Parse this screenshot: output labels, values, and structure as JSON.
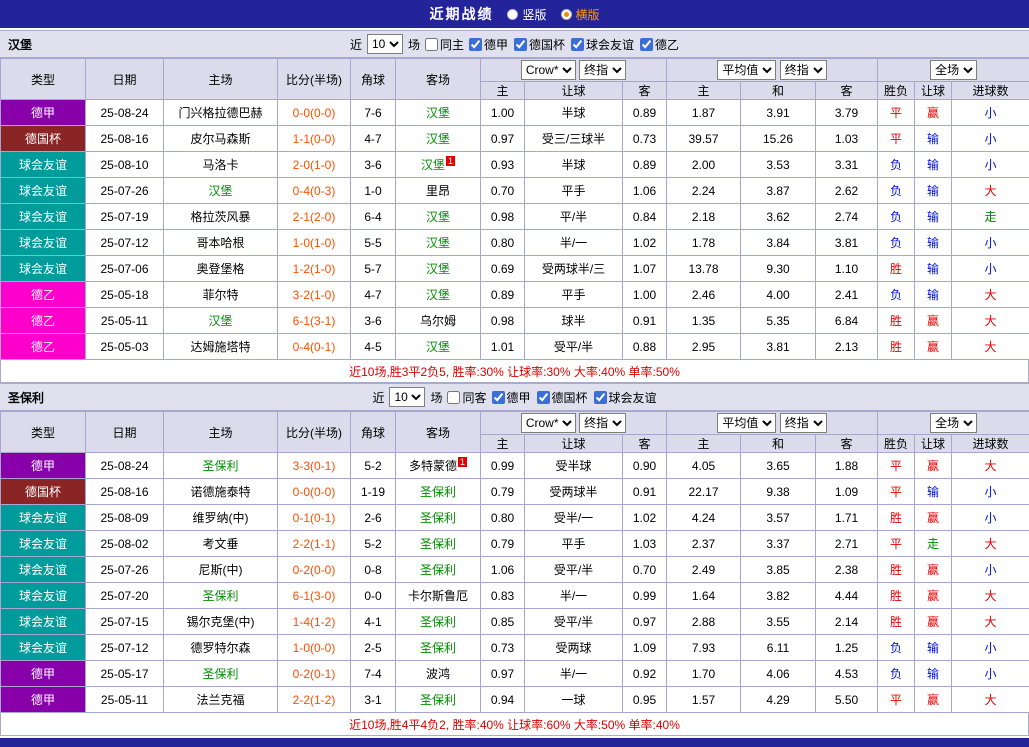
{
  "topbar": {
    "title": "近期战绩",
    "layout_vertical": "竖版",
    "layout_horizontal": "横版"
  },
  "league_colors": {
    "德甲": "#8800AA",
    "德国杯": "#8B2525",
    "球会友谊": "#009C9C",
    "德乙": "#FF00CC"
  },
  "status_colors": {
    "win": "#E60000",
    "loss": "#0010DD",
    "push": "#008A00",
    "score": "#FF5000",
    "focus_team": "#009000"
  },
  "table_header": {
    "type": "类型",
    "date": "日期",
    "home": "主场",
    "score": "比分(半场)",
    "corner": "角球",
    "away": "客场",
    "odds_company": "Crow*",
    "odds_kind": "终指",
    "avg_label": "平均值",
    "avg_kind": "终指",
    "full_label": "全场",
    "odds_sub_home": "主",
    "odds_sub_handicap": "让球",
    "odds_sub_away": "客",
    "avg_sub_home": "主",
    "avg_sub_draw": "和",
    "avg_sub_away": "客",
    "res_sub_outcome": "胜负",
    "res_sub_handicap": "让球",
    "res_sub_goals": "进球数"
  },
  "sections": [
    {
      "team": "汉堡",
      "filter": {
        "prefix": "近",
        "count": "10",
        "suffix": "场",
        "venue_label": "同主",
        "leagues": [
          "德甲",
          "德国杯",
          "球会友谊",
          "德乙"
        ]
      },
      "rows": [
        {
          "league": "德甲",
          "date": "25-08-24",
          "home": "门兴格拉德巴赫",
          "home_focus": false,
          "score": "0-0(0-0)",
          "corner": "7-6",
          "away": "汉堡",
          "away_focus": true,
          "away_rank": "",
          "odds": [
            "1.00",
            "半球",
            "0.89"
          ],
          "avg": [
            "1.87",
            "3.91",
            "3.79"
          ],
          "result": [
            "平",
            "赢",
            "小"
          ]
        },
        {
          "league": "德国杯",
          "date": "25-08-16",
          "home": "皮尔马森斯",
          "home_focus": false,
          "score": "1-1(0-0)",
          "corner": "4-7",
          "away": "汉堡",
          "away_focus": true,
          "away_rank": "",
          "odds": [
            "0.97",
            "受三/三球半",
            "0.73"
          ],
          "avg": [
            "39.57",
            "15.26",
            "1.03"
          ],
          "result": [
            "平",
            "输",
            "小"
          ]
        },
        {
          "league": "球会友谊",
          "date": "25-08-10",
          "home": "马洛卡",
          "home_focus": false,
          "score": "2-0(1-0)",
          "corner": "3-6",
          "away": "汉堡",
          "away_focus": true,
          "away_rank": "1",
          "odds": [
            "0.93",
            "半球",
            "0.89"
          ],
          "avg": [
            "2.00",
            "3.53",
            "3.31"
          ],
          "result": [
            "负",
            "输",
            "小"
          ]
        },
        {
          "league": "球会友谊",
          "date": "25-07-26",
          "home": "汉堡",
          "home_focus": true,
          "score": "0-4(0-3)",
          "corner": "1-0",
          "away": "里昂",
          "away_focus": false,
          "away_rank": "",
          "odds": [
            "0.70",
            "平手",
            "1.06"
          ],
          "avg": [
            "2.24",
            "3.87",
            "2.62"
          ],
          "result": [
            "负",
            "输",
            "大"
          ]
        },
        {
          "league": "球会友谊",
          "date": "25-07-19",
          "home": "格拉茨风暴",
          "home_focus": false,
          "score": "2-1(2-0)",
          "corner": "6-4",
          "away": "汉堡",
          "away_focus": true,
          "away_rank": "",
          "odds": [
            "0.98",
            "平/半",
            "0.84"
          ],
          "avg": [
            "2.18",
            "3.62",
            "2.74"
          ],
          "result": [
            "负",
            "输",
            "走"
          ]
        },
        {
          "league": "球会友谊",
          "date": "25-07-12",
          "home": "哥本哈根",
          "home_focus": false,
          "score": "1-0(1-0)",
          "corner": "5-5",
          "away": "汉堡",
          "away_focus": true,
          "away_rank": "",
          "odds": [
            "0.80",
            "半/一",
            "1.02"
          ],
          "avg": [
            "1.78",
            "3.84",
            "3.81"
          ],
          "result": [
            "负",
            "输",
            "小"
          ]
        },
        {
          "league": "球会友谊",
          "date": "25-07-06",
          "home": "奥登堡格",
          "home_focus": false,
          "score": "1-2(1-0)",
          "corner": "5-7",
          "away": "汉堡",
          "away_focus": true,
          "away_rank": "",
          "odds": [
            "0.69",
            "受两球半/三",
            "1.07"
          ],
          "avg": [
            "13.78",
            "9.30",
            "1.10"
          ],
          "result": [
            "胜",
            "输",
            "小"
          ]
        },
        {
          "league": "德乙",
          "date": "25-05-18",
          "home": "菲尔特",
          "home_focus": false,
          "score": "3-2(1-0)",
          "corner": "4-7",
          "away": "汉堡",
          "away_focus": true,
          "away_rank": "",
          "odds": [
            "0.89",
            "平手",
            "1.00"
          ],
          "avg": [
            "2.46",
            "4.00",
            "2.41"
          ],
          "result": [
            "负",
            "输",
            "大"
          ]
        },
        {
          "league": "德乙",
          "date": "25-05-11",
          "home": "汉堡",
          "home_focus": true,
          "score": "6-1(3-1)",
          "corner": "3-6",
          "away": "乌尔姆",
          "away_focus": false,
          "away_rank": "",
          "odds": [
            "0.98",
            "球半",
            "0.91"
          ],
          "avg": [
            "1.35",
            "5.35",
            "6.84"
          ],
          "result": [
            "胜",
            "赢",
            "大"
          ]
        },
        {
          "league": "德乙",
          "date": "25-05-03",
          "home": "达姆施塔特",
          "home_focus": false,
          "score": "0-4(0-1)",
          "corner": "4-5",
          "away": "汉堡",
          "away_focus": true,
          "away_rank": "",
          "odds": [
            "1.01",
            "受平/半",
            "0.88"
          ],
          "avg": [
            "2.95",
            "3.81",
            "2.13"
          ],
          "result": [
            "胜",
            "赢",
            "大"
          ]
        }
      ],
      "footer": "近10场,胜3平2负5, 胜率:30% 让球率:30% 大率:40% 单率:50%"
    },
    {
      "team": "圣保利",
      "filter": {
        "prefix": "近",
        "count": "10",
        "suffix": "场",
        "venue_label": "同客",
        "leagues": [
          "德甲",
          "德国杯",
          "球会友谊"
        ]
      },
      "rows": [
        {
          "league": "德甲",
          "date": "25-08-24",
          "home": "圣保利",
          "home_focus": true,
          "score": "3-3(0-1)",
          "corner": "5-2",
          "away": "多特蒙德",
          "away_focus": false,
          "away_rank": "1",
          "odds": [
            "0.99",
            "受半球",
            "0.90"
          ],
          "avg": [
            "4.05",
            "3.65",
            "1.88"
          ],
          "result": [
            "平",
            "赢",
            "大"
          ]
        },
        {
          "league": "德国杯",
          "date": "25-08-16",
          "home": "诺德施泰特",
          "home_focus": false,
          "score": "0-0(0-0)",
          "corner": "1-19",
          "away": "圣保利",
          "away_focus": true,
          "away_rank": "",
          "odds": [
            "0.79",
            "受两球半",
            "0.91"
          ],
          "avg": [
            "22.17",
            "9.38",
            "1.09"
          ],
          "result": [
            "平",
            "输",
            "小"
          ]
        },
        {
          "league": "球会友谊",
          "date": "25-08-09",
          "home": "维罗纳(中)",
          "home_focus": false,
          "score": "0-1(0-1)",
          "corner": "2-6",
          "away": "圣保利",
          "away_focus": true,
          "away_rank": "",
          "odds": [
            "0.80",
            "受半/一",
            "1.02"
          ],
          "avg": [
            "4.24",
            "3.57",
            "1.71"
          ],
          "result": [
            "胜",
            "赢",
            "小"
          ]
        },
        {
          "league": "球会友谊",
          "date": "25-08-02",
          "home": "考文垂",
          "home_focus": false,
          "score": "2-2(1-1)",
          "corner": "5-2",
          "away": "圣保利",
          "away_focus": true,
          "away_rank": "",
          "odds": [
            "0.79",
            "平手",
            "1.03"
          ],
          "avg": [
            "2.37",
            "3.37",
            "2.71"
          ],
          "result": [
            "平",
            "走",
            "大"
          ]
        },
        {
          "league": "球会友谊",
          "date": "25-07-26",
          "home": "尼斯(中)",
          "home_focus": false,
          "score": "0-2(0-0)",
          "corner": "0-8",
          "away": "圣保利",
          "away_focus": true,
          "away_rank": "",
          "odds": [
            "1.06",
            "受平/半",
            "0.70"
          ],
          "avg": [
            "2.49",
            "3.85",
            "2.38"
          ],
          "result": [
            "胜",
            "赢",
            "小"
          ]
        },
        {
          "league": "球会友谊",
          "date": "25-07-20",
          "home": "圣保利",
          "home_focus": true,
          "score": "6-1(3-0)",
          "corner": "0-0",
          "away": "卡尔斯鲁厄",
          "away_focus": false,
          "away_rank": "",
          "odds": [
            "0.83",
            "半/一",
            "0.99"
          ],
          "avg": [
            "1.64",
            "3.82",
            "4.44"
          ],
          "result": [
            "胜",
            "赢",
            "大"
          ]
        },
        {
          "league": "球会友谊",
          "date": "25-07-15",
          "home": "锡尔克堡(中)",
          "home_focus": false,
          "score": "1-4(1-2)",
          "corner": "4-1",
          "away": "圣保利",
          "away_focus": true,
          "away_rank": "",
          "odds": [
            "0.85",
            "受平/半",
            "0.97"
          ],
          "avg": [
            "2.88",
            "3.55",
            "2.14"
          ],
          "result": [
            "胜",
            "赢",
            "大"
          ]
        },
        {
          "league": "球会友谊",
          "date": "25-07-12",
          "home": "德罗特尔森",
          "home_focus": false,
          "score": "1-0(0-0)",
          "corner": "2-5",
          "away": "圣保利",
          "away_focus": true,
          "away_rank": "",
          "odds": [
            "0.73",
            "受两球",
            "1.09"
          ],
          "avg": [
            "7.93",
            "6.11",
            "1.25"
          ],
          "result": [
            "负",
            "输",
            "小"
          ]
        },
        {
          "league": "德甲",
          "date": "25-05-17",
          "home": "圣保利",
          "home_focus": true,
          "score": "0-2(0-1)",
          "corner": "7-4",
          "away": "波鸿",
          "away_focus": false,
          "away_rank": "",
          "odds": [
            "0.97",
            "半/一",
            "0.92"
          ],
          "avg": [
            "1.70",
            "4.06",
            "4.53"
          ],
          "result": [
            "负",
            "输",
            "小"
          ]
        },
        {
          "league": "德甲",
          "date": "25-05-11",
          "home": "法兰克福",
          "home_focus": false,
          "score": "2-2(1-2)",
          "corner": "3-1",
          "away": "圣保利",
          "away_focus": true,
          "away_rank": "",
          "odds": [
            "0.94",
            "一球",
            "0.95"
          ],
          "avg": [
            "1.57",
            "4.29",
            "5.50"
          ],
          "result": [
            "平",
            "赢",
            "大"
          ]
        }
      ],
      "footer": "近10场,胜4平4负2, 胜率:40% 让球率:60% 大率:50% 单率:40%"
    }
  ]
}
